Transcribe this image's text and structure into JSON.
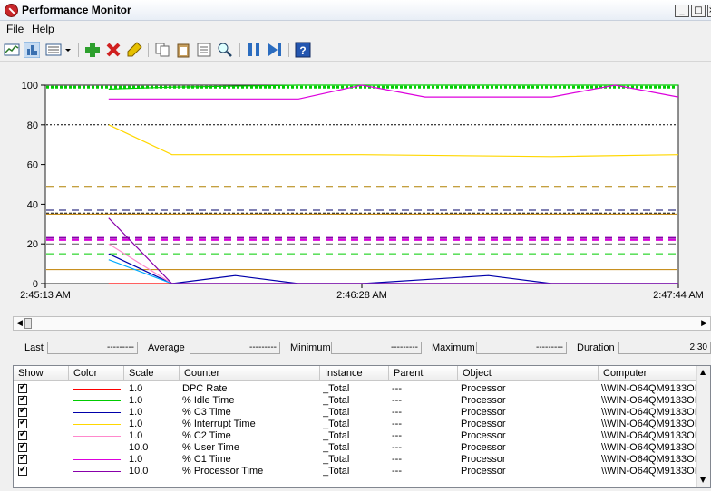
{
  "window": {
    "title": "Performance Monitor",
    "controls": [
      "_",
      "□",
      "×"
    ]
  },
  "menu": {
    "items": [
      "File",
      "Help"
    ]
  },
  "toolbar": {
    "icons": [
      "view-graph-icon",
      "view-histogram-icon",
      "change-graph-type-icon",
      "dropdown-icon",
      "add-counter-icon",
      "delete-counter-icon",
      "highlight-icon",
      "copy-properties-icon",
      "paste-counter-list-icon",
      "properties-icon",
      "zoom-icon",
      "freeze-display-icon",
      "update-data-icon",
      "help-icon"
    ]
  },
  "chart_data": {
    "type": "line",
    "yaxis": {
      "min": 0,
      "max": 100,
      "ticks": [
        "0",
        "20",
        "40",
        "60",
        "80",
        "100"
      ]
    },
    "x_labels": [
      "2:45:13 AM",
      "2:46:28 AM",
      "2:47:44 AM"
    ],
    "x_label_positions": [
      0,
      0.5,
      1
    ],
    "grid": false,
    "series": [
      {
        "name": "DPC Rate",
        "color": "#ff0000",
        "points": [
          [
            0.1,
            0
          ],
          [
            0.2,
            0
          ],
          [
            0.4,
            0
          ],
          [
            0.6,
            0
          ],
          [
            0.8,
            0
          ],
          [
            1.0,
            0
          ]
        ]
      },
      {
        "name": "% Idle Time",
        "color": "#00cc00",
        "points": [
          [
            0.1,
            98
          ],
          [
            0.2,
            99
          ],
          [
            0.4,
            100
          ],
          [
            0.6,
            100
          ],
          [
            0.8,
            100
          ],
          [
            1.0,
            100
          ]
        ]
      },
      {
        "name": "% C3 Time",
        "color": "#0000aa",
        "points": [
          [
            0.1,
            15
          ],
          [
            0.2,
            0
          ],
          [
            0.3,
            4
          ],
          [
            0.4,
            0
          ],
          [
            0.5,
            0
          ],
          [
            0.7,
            4
          ],
          [
            0.8,
            0
          ],
          [
            1.0,
            0
          ]
        ]
      },
      {
        "name": "% Interrupt Time",
        "color": "#ffd700",
        "points": [
          [
            0.1,
            80
          ],
          [
            0.2,
            65
          ],
          [
            0.5,
            65
          ],
          [
            0.8,
            64
          ],
          [
            1.0,
            65
          ]
        ]
      },
      {
        "name": "% C2 Time",
        "color": "#ff88cc",
        "points": [
          [
            0.1,
            20
          ],
          [
            0.2,
            0
          ],
          [
            1.0,
            0
          ]
        ]
      },
      {
        "name": "% User Time",
        "color": "#00aaff",
        "points": [
          [
            0.1,
            12
          ],
          [
            0.2,
            0
          ],
          [
            1.0,
            0
          ]
        ]
      },
      {
        "name": "% C1 Time",
        "color": "#dd00dd",
        "points": [
          [
            0.1,
            93
          ],
          [
            0.4,
            93
          ],
          [
            0.5,
            100
          ],
          [
            0.6,
            94
          ],
          [
            0.8,
            94
          ],
          [
            0.9,
            100
          ],
          [
            1.0,
            94
          ]
        ]
      },
      {
        "name": "% Processor Time",
        "color": "#8800aa",
        "points": [
          [
            0.1,
            33
          ],
          [
            0.2,
            0
          ],
          [
            1.0,
            0
          ]
        ]
      }
    ]
  },
  "stats": {
    "last_label": "Last",
    "last_value": "---------",
    "average_label": "Average",
    "average_value": "---------",
    "minimum_label": "Minimum",
    "minimum_value": "---------",
    "maximum_label": "Maximum",
    "maximum_value": "---------",
    "duration_label": "Duration",
    "duration_value": "2:30"
  },
  "table": {
    "headers": [
      "Show",
      "Color",
      "Scale",
      "Counter",
      "Instance",
      "Parent",
      "Object",
      "Computer"
    ],
    "rows": [
      {
        "scale": "1.0",
        "counter": "DPC Rate",
        "instance": "_Total",
        "parent": "---",
        "object": "Processor",
        "computer": "\\\\WIN-O64QM9133OI",
        "color": "#ff0000"
      },
      {
        "scale": "1.0",
        "counter": "% Idle Time",
        "instance": "_Total",
        "parent": "---",
        "object": "Processor",
        "computer": "\\\\WIN-O64QM9133OI",
        "color": "#00cc00"
      },
      {
        "scale": "1.0",
        "counter": "% C3 Time",
        "instance": "_Total",
        "parent": "---",
        "object": "Processor",
        "computer": "\\\\WIN-O64QM9133OI",
        "color": "#0000aa"
      },
      {
        "scale": "1.0",
        "counter": "% Interrupt Time",
        "instance": "_Total",
        "parent": "---",
        "object": "Processor",
        "computer": "\\\\WIN-O64QM9133OI",
        "color": "#ffd700"
      },
      {
        "scale": "1.0",
        "counter": "% C2 Time",
        "instance": "_Total",
        "parent": "---",
        "object": "Processor",
        "computer": "\\\\WIN-O64QM9133OI",
        "color": "#ff88cc"
      },
      {
        "scale": "10.0",
        "counter": "% User Time",
        "instance": "_Total",
        "parent": "---",
        "object": "Processor",
        "computer": "\\\\WIN-O64QM9133OI",
        "color": "#00aaff"
      },
      {
        "scale": "1.0",
        "counter": "% C1 Time",
        "instance": "_Total",
        "parent": "---",
        "object": "Processor",
        "computer": "\\\\WIN-O64QM9133OI",
        "color": "#dd00dd"
      },
      {
        "scale": "10.0",
        "counter": "% Processor Time",
        "instance": "_Total",
        "parent": "---",
        "object": "Processor",
        "computer": "\\\\WIN-O64QM9133OI",
        "color": "#8800aa"
      }
    ]
  }
}
